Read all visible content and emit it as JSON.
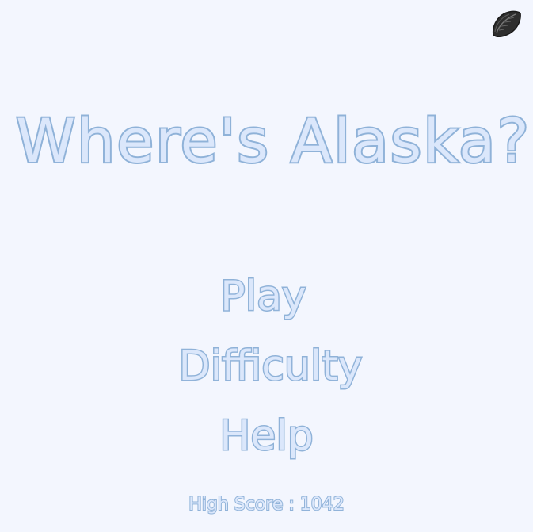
{
  "title": "Where's Alaska?",
  "menu": {
    "play_label": "Play",
    "difficulty_label": "Difficulty",
    "help_label": "Help"
  },
  "high_score": {
    "label": "High Score : ",
    "value": "1042"
  },
  "icons": {
    "corner_button": "leaf-icon"
  },
  "colors": {
    "background": "#f3f6fe",
    "text_fill": "#dbe7fb",
    "text_outline": "#8fb2d8",
    "leaf": "#3c3c3c"
  }
}
